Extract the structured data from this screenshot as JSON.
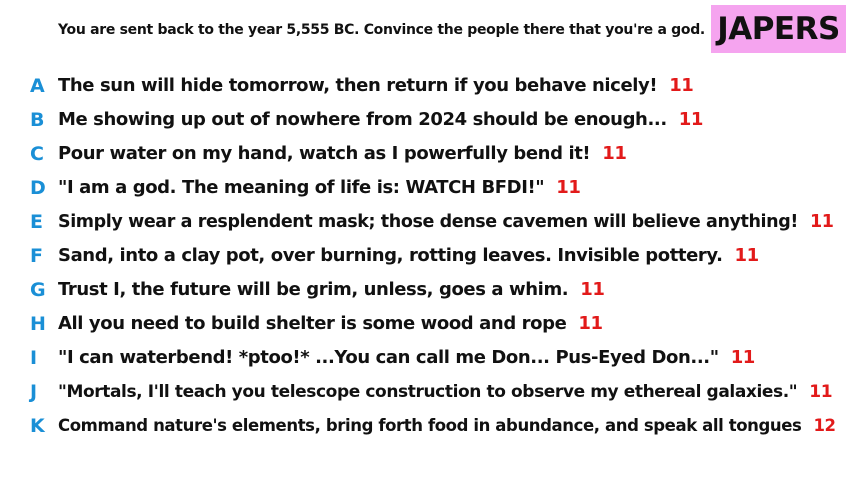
{
  "prompt": "You are sent back to the year 5,555 BC. Convince the people there that you're a god.",
  "badge": "JAPERS",
  "colors": {
    "letter": "#1a8fd6",
    "count": "#e21a1a",
    "badge_bg": "#f5a4ef",
    "text": "#111111"
  },
  "answers": [
    {
      "letter": "A",
      "text": "The sun will hide tomorrow, then return if you behave nicely!",
      "count": "11"
    },
    {
      "letter": "B",
      "text": "Me showing up out of nowhere from 2024 should be enough...",
      "count": "11"
    },
    {
      "letter": "C",
      "text": "Pour water on my hand, watch as I powerfully bend it!",
      "count": "11"
    },
    {
      "letter": "D",
      "text": "\"I am a god. The meaning of life is: WATCH BFDI!\"",
      "count": "11"
    },
    {
      "letter": "E",
      "text": "Simply wear a resplendent mask; those dense cavemen will believe anything!",
      "count": "11"
    },
    {
      "letter": "F",
      "text": "Sand, into a clay pot, over burning, rotting leaves. Invisible pottery.",
      "count": "11"
    },
    {
      "letter": "G",
      "text": "Trust I, the future will be grim, unless, goes a whim.",
      "count": "11"
    },
    {
      "letter": "H",
      "text": "All you need to build shelter is some wood and rope",
      "count": "11"
    },
    {
      "letter": "I",
      "text": "\"I can waterbend! *ptoo!* ...You can call me Don... Pus-Eyed Don...\"",
      "count": "11"
    },
    {
      "letter": "J",
      "text": "\"Mortals, I'll teach you telescope construction to observe my ethereal galaxies.\"",
      "count": "11"
    },
    {
      "letter": "K",
      "text": "Command nature's elements, bring forth food in abundance, and speak all tongues",
      "count": "12"
    }
  ]
}
